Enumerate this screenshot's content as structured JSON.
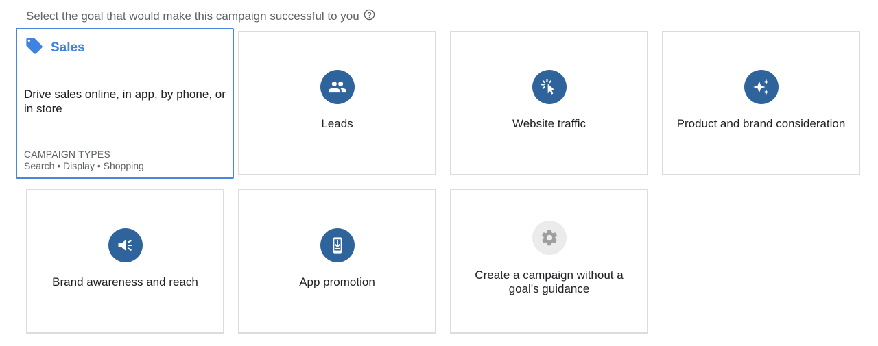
{
  "header": {
    "prompt": "Select the goal that would make this campaign successful to you",
    "help_icon": "help-circle-icon"
  },
  "colors": {
    "accent": "#4a86d9",
    "icon_circle": "#2f639b",
    "selected_title": "#3f82df",
    "disabled_circle": "#ebebeb"
  },
  "goals": [
    {
      "id": "sales",
      "icon": "tag-icon",
      "label": "Sales",
      "description": "Drive sales online, in app, by phone, or in store",
      "campaign_types_title": "CAMPAIGN TYPES",
      "campaign_types": "Search • Display • Shopping",
      "selected": true
    },
    {
      "id": "leads",
      "icon": "people-icon",
      "label": "Leads",
      "selected": false
    },
    {
      "id": "website-traffic",
      "icon": "cursor-click-icon",
      "label": "Website traffic",
      "selected": false
    },
    {
      "id": "product-brand-consideration",
      "icon": "sparkle-icon",
      "label": "Product and brand consideration",
      "selected": false
    },
    {
      "id": "brand-awareness-reach",
      "icon": "megaphone-icon",
      "label": "Brand awareness and reach",
      "selected": false
    },
    {
      "id": "app-promotion",
      "icon": "phone-download-icon",
      "label": "App promotion",
      "selected": false
    },
    {
      "id": "no-goal",
      "icon": "gear-icon",
      "label": "Create a campaign without a goal's guidance",
      "selected": false
    }
  ]
}
